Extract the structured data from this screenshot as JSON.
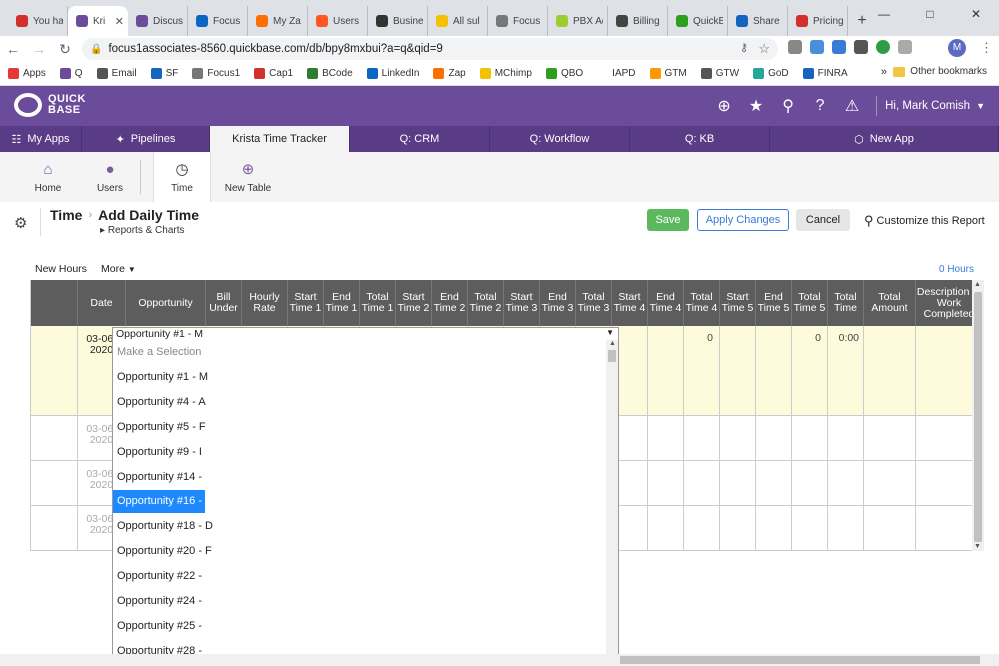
{
  "browser": {
    "tabs": [
      {
        "label": "You ha",
        "color": "#d32f2f"
      },
      {
        "label": "Kri",
        "color": "#6b4c9a"
      },
      {
        "label": "Discus",
        "color": "#6b4c9a"
      },
      {
        "label": "Focus",
        "color": "#0a66c2"
      },
      {
        "label": "My Za",
        "color": "#ff6f00"
      },
      {
        "label": "Users",
        "color": "#ff5722"
      },
      {
        "label": "Busine",
        "color": "#333333"
      },
      {
        "label": "All sul",
        "color": "#f2c200"
      },
      {
        "label": "Focus",
        "color": "#777777"
      },
      {
        "label": "PBX Ad",
        "color": "#9ccc32"
      },
      {
        "label": "Billing",
        "color": "#444444"
      },
      {
        "label": "QuickB",
        "color": "#2ca01c"
      },
      {
        "label": "Share",
        "color": "#1565c0"
      },
      {
        "label": "Pricing",
        "color": "#d32f2f"
      }
    ],
    "active_tab": 1,
    "url": "focus1associates-8560.quickbase.com/db/bpy8mxbui?a=q&qid=9",
    "profile_initial": "M",
    "bookmarks": [
      {
        "label": "Apps",
        "color": "#e53935"
      },
      {
        "label": "Q",
        "color": "#6b4c9a"
      },
      {
        "label": "Email",
        "color": "#555555"
      },
      {
        "label": "SF",
        "color": "#1565c0"
      },
      {
        "label": "Focus1",
        "color": "#777777"
      },
      {
        "label": "Cap1",
        "color": "#d32f2f"
      },
      {
        "label": "BCode",
        "color": "#2e7d32"
      },
      {
        "label": "LinkedIn",
        "color": "#0a66c2"
      },
      {
        "label": "Zap",
        "color": "#ff6f00"
      },
      {
        "label": "MChimp",
        "color": "#f2c200"
      },
      {
        "label": "QBO",
        "color": "#2ca01c"
      },
      {
        "label": "IAPD",
        "color": "#ffffff"
      },
      {
        "label": "GTM",
        "color": "#ff9800"
      },
      {
        "label": "GTW",
        "color": "#555555"
      },
      {
        "label": "GoD",
        "color": "#26a69a"
      },
      {
        "label": "FINRA",
        "color": "#1565c0"
      }
    ],
    "bookmarks_more": "»",
    "other_bookmarks": "Other bookmarks"
  },
  "qb": {
    "logo_line1": "QUICK",
    "logo_line2": "BASE",
    "user_greeting": "Hi, Mark Comish",
    "app_tabs": [
      {
        "label": "My Apps",
        "icon": "grid-icon"
      },
      {
        "label": "Pipelines",
        "icon": "pipelines-icon"
      },
      {
        "label": "Krista Time Tracker",
        "icon": ""
      },
      {
        "label": "Q: CRM",
        "icon": ""
      },
      {
        "label": "Q: Workflow",
        "icon": ""
      },
      {
        "label": "Q: KB",
        "icon": ""
      },
      {
        "label": "New App",
        "icon": "cube-icon"
      }
    ],
    "subnav": [
      {
        "label": "Home",
        "icon": "home-icon"
      },
      {
        "label": "Users",
        "icon": "user-icon"
      },
      {
        "label": "Time",
        "icon": "clock-icon"
      },
      {
        "label": "New Table",
        "icon": "plus-icon"
      }
    ]
  },
  "page": {
    "table_name": "Time",
    "title": "Add Daily Time",
    "reports_link": "Reports & Charts",
    "save": "Save",
    "apply": "Apply Changes",
    "cancel": "Cancel",
    "customize": "Customize this Report",
    "new_hours": "New Hours",
    "more": "More",
    "hours_total": "0 Hours"
  },
  "grid": {
    "columns": [
      "Date",
      "Opportunity",
      "Bill Under",
      "Hourly Rate",
      "Start Time 1",
      "End Time 1",
      "Total Time 1",
      "Start Time 2",
      "End Time 2",
      "Total Time 2",
      "Start Time 3",
      "End Time 3",
      "Total Time 3",
      "Start Time 4",
      "End Time 4",
      "Total Time 4",
      "Start Time 5",
      "End Time 5",
      "Total Time 5",
      "Total Time",
      "Total Amount",
      "Description of Work Completed"
    ],
    "rows": [
      {
        "date": "03-06-2020",
        "total4": "0",
        "total5": "0",
        "total_time": "0:00",
        "active": true
      },
      {
        "date": "03-06-2020",
        "total4": "",
        "total5": "",
        "total_time": "",
        "active": false
      },
      {
        "date": "03-06-2020",
        "total4": "",
        "total5": "",
        "total_time": "",
        "active": false
      },
      {
        "date": "03-06-2020",
        "total4": "",
        "total5": "",
        "total_time": "",
        "active": false
      }
    ]
  },
  "dropdown": {
    "selected": "Opportunity #1 - M",
    "options": [
      "Make a Selection",
      "Opportunity #1 - M",
      "Opportunity #4 - A",
      "Opportunity #5 - F",
      "Opportunity #9 - I",
      "Opportunity #14 -",
      "Opportunity #16 - C",
      "Opportunity #18 - D",
      "Opportunity #20 - F",
      "Opportunity #22 -",
      "Opportunity #24 -",
      "Opportunity #25 -",
      "Opportunity #28 -"
    ],
    "highlighted_index": 6
  }
}
